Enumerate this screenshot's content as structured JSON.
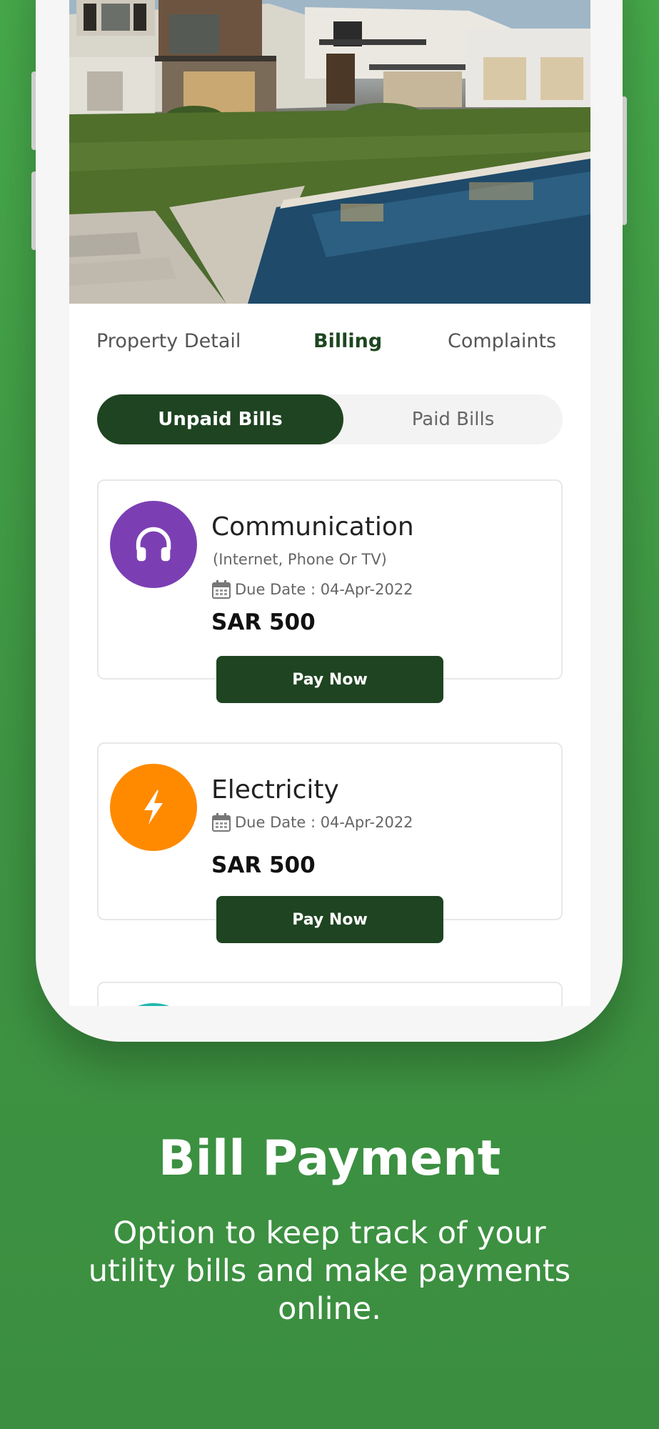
{
  "tabs": {
    "property_detail": "Property Detail",
    "billing": "Billing",
    "complaints": "Complaints"
  },
  "bill_toggle": {
    "unpaid": "Unpaid Bills",
    "paid": "Paid Bills"
  },
  "bills": [
    {
      "title": "Communication",
      "subtitle": "(Internet, Phone Or TV)",
      "due_date": "Due Date : 04-Apr-2022",
      "amount": "SAR 500",
      "pay_label": "Pay Now",
      "icon": "headphones-icon",
      "color": "#7b3fb3"
    },
    {
      "title": "Electricity",
      "due_date": "Due Date : 04-Apr-2022",
      "amount": "SAR 500",
      "pay_label": "Pay Now",
      "icon": "lightning-icon",
      "color": "#ff8a00"
    },
    {
      "color": "#22b8b0"
    }
  ],
  "promo": {
    "headline": "Bill Payment",
    "description": "Option to keep track of your utility bills and make payments online."
  },
  "colors": {
    "background": "#46a84a",
    "primary": "#1f4421"
  }
}
